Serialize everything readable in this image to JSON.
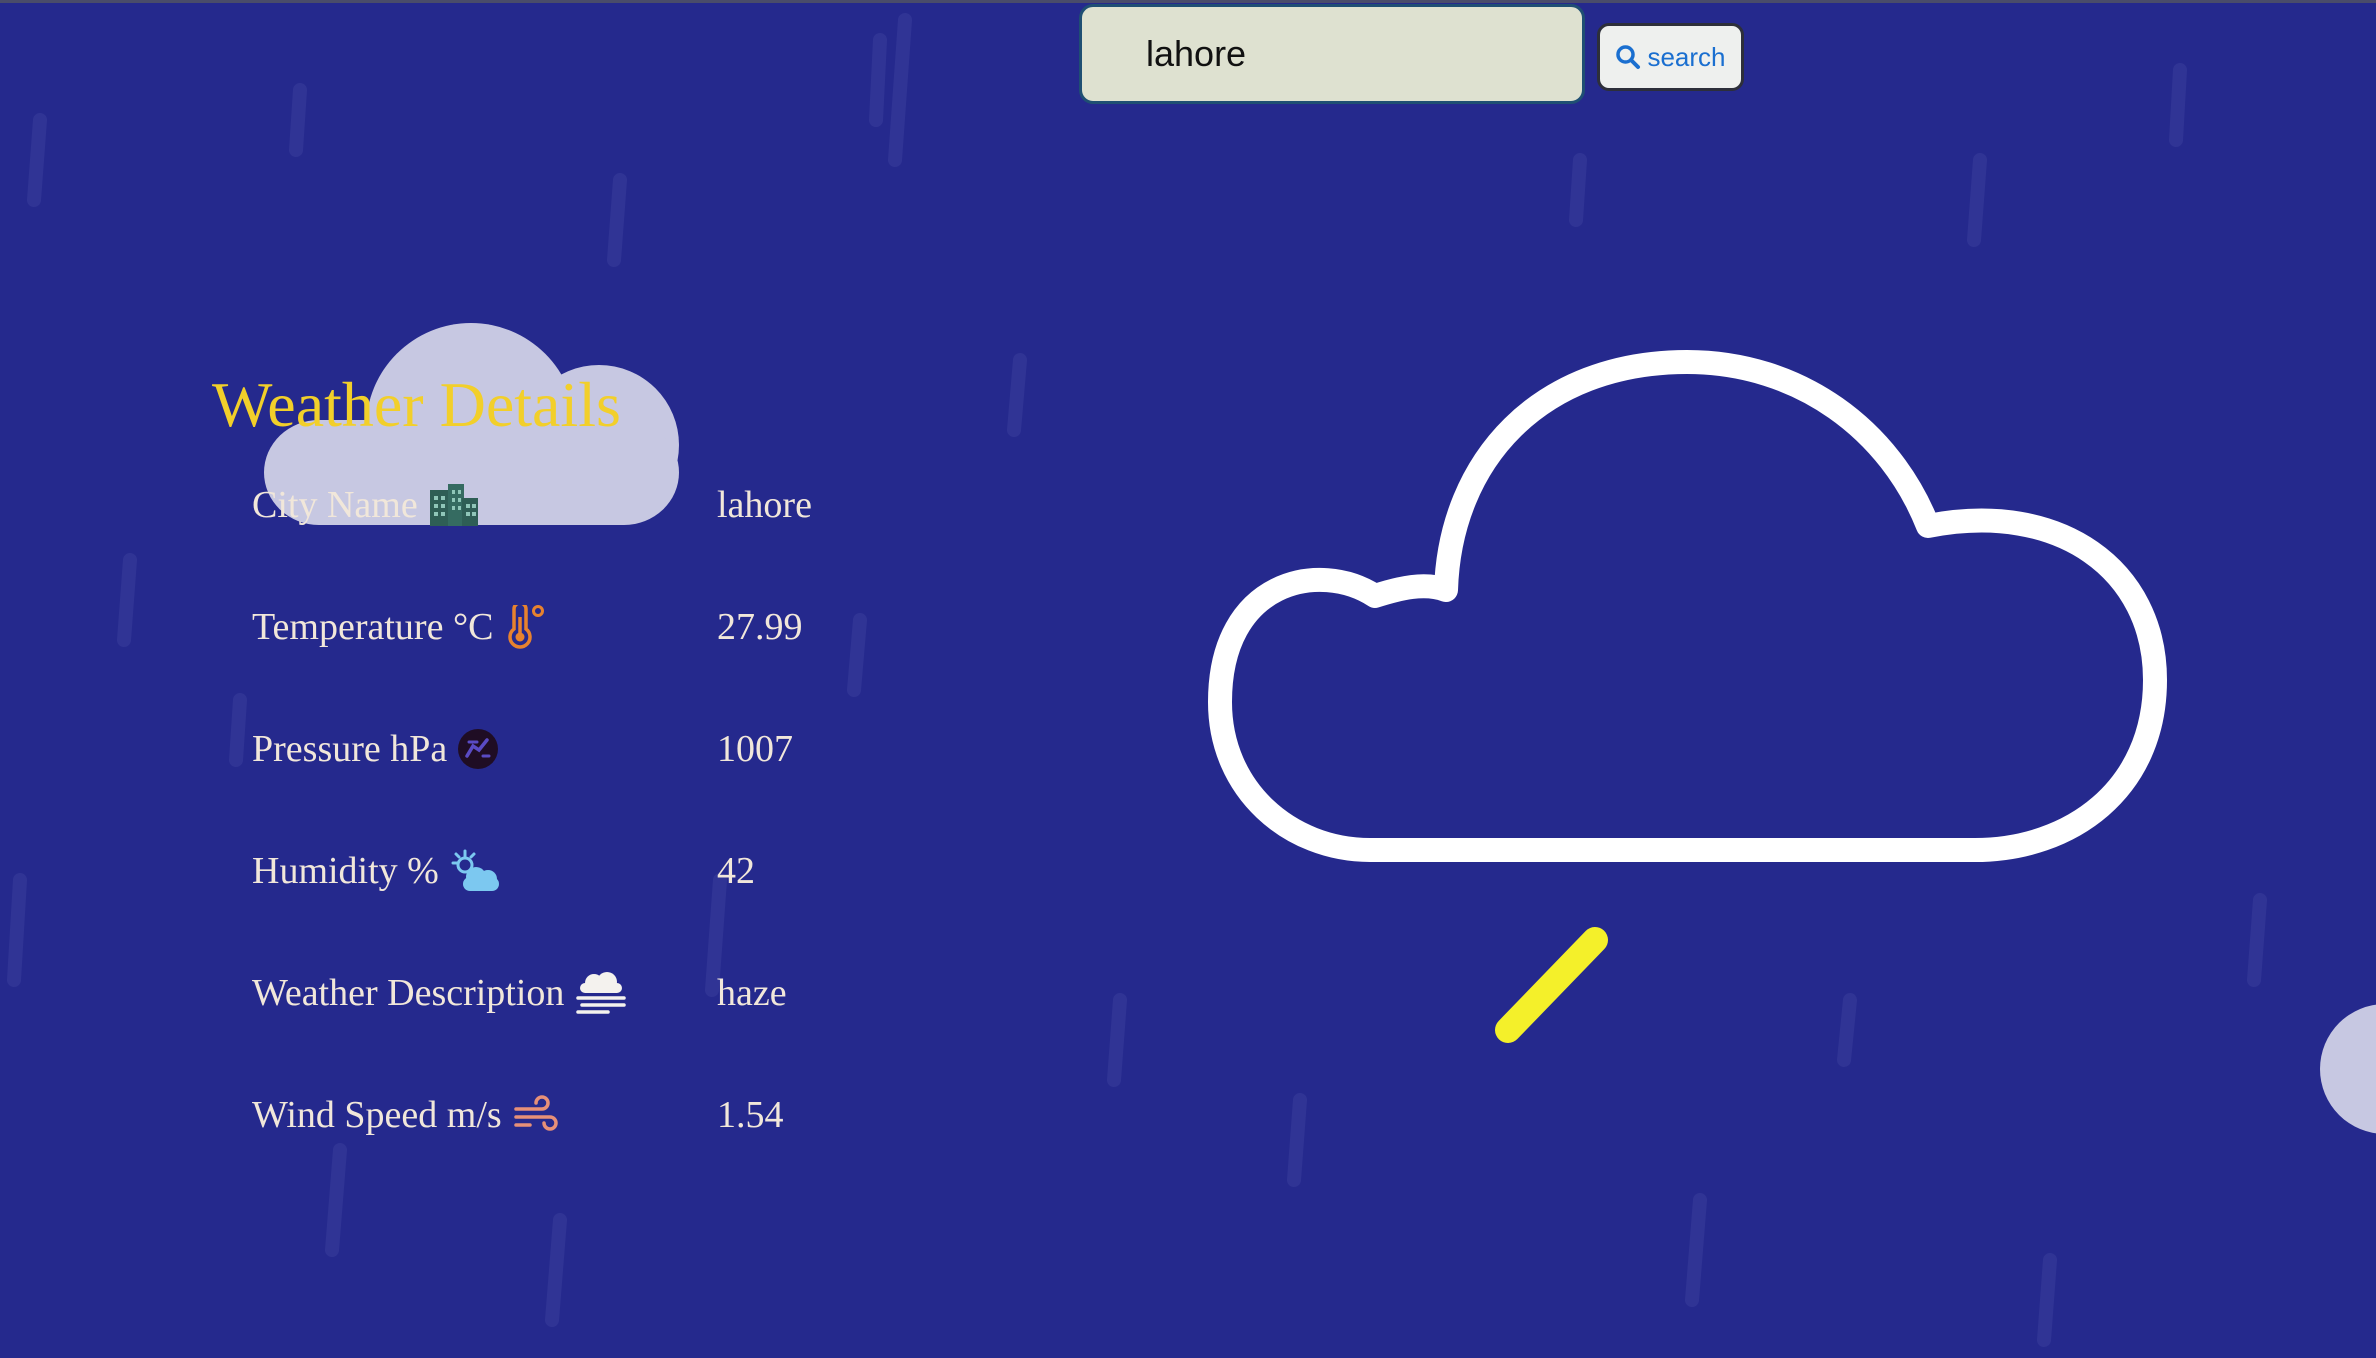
{
  "search": {
    "value": "lahore",
    "button_label": "search",
    "button_icon": "search-icon"
  },
  "title": "Weather Details",
  "details": [
    {
      "label": "City Name",
      "icon": "city-icon",
      "value": "lahore"
    },
    {
      "label": "Temperature °C",
      "icon": "thermometer-icon",
      "value": "27.99"
    },
    {
      "label": "Pressure hPa",
      "icon": "pressure-icon",
      "value": "1007"
    },
    {
      "label": "Humidity %",
      "icon": "sun-cloud-icon",
      "value": "42"
    },
    {
      "label": "Weather Description",
      "icon": "fog-icon",
      "value": "haze"
    },
    {
      "label": "Wind Speed m/s",
      "icon": "wind-icon",
      "value": "1.54"
    }
  ],
  "colors": {
    "background": "#25298d",
    "title": "#f2cf2a",
    "text": "#f1e7da",
    "search_field": "#dee1d0",
    "button_text": "#1a6fd0",
    "bolt": "#f4f02a"
  }
}
